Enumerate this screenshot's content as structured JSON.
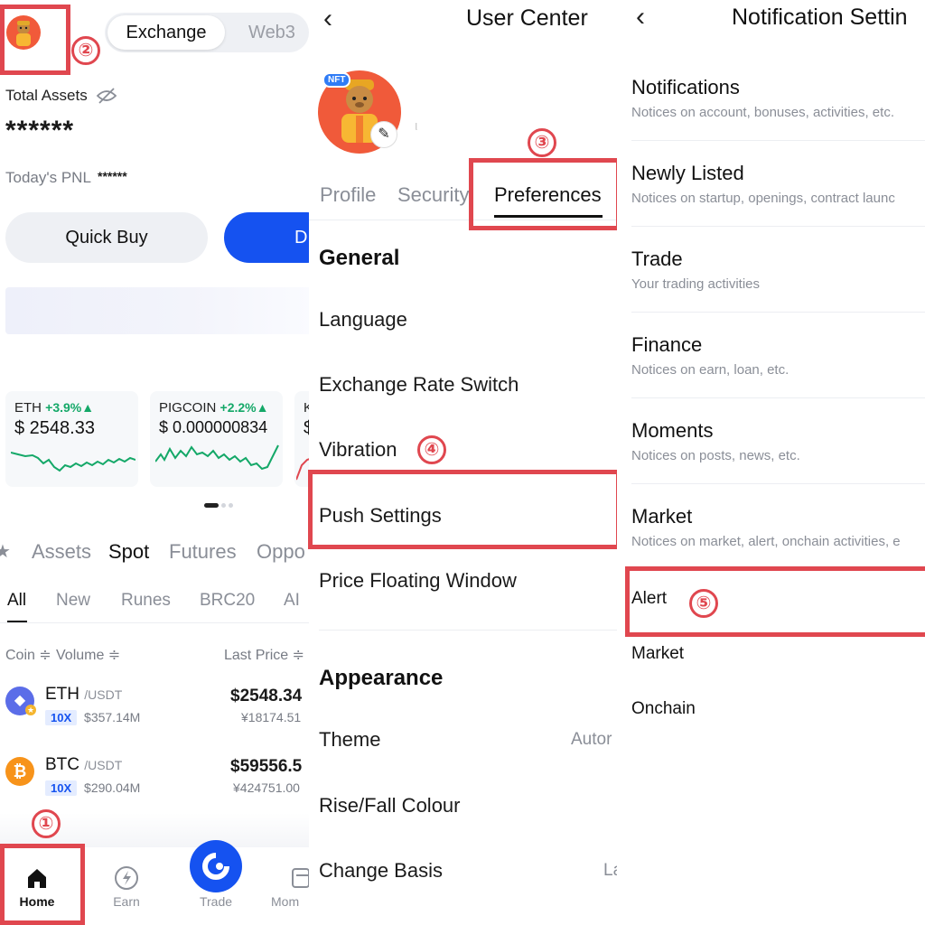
{
  "colors": {
    "accent": "#1552f0",
    "up": "#14a868",
    "annotation": "#e0474f",
    "text_muted": "#8a8e97"
  },
  "home": {
    "segment": {
      "active": "Exchange",
      "inactive": "Web3"
    },
    "total_assets_label": "Total Assets",
    "total_assets_value": "******",
    "pnl_label": "Today's PNL",
    "pnl_value": "******",
    "quick_buy_label": "Quick Buy",
    "deposit_label_partial": "D",
    "cards": [
      {
        "symbol": "ETH",
        "change": "+3.9%▲",
        "price": "$ 2548.33"
      },
      {
        "symbol": "PIGCOIN",
        "change": "+2.2%▲",
        "price": "$ 0.000000834"
      },
      {
        "symbol": "K",
        "change": "",
        "price": "$"
      }
    ],
    "market_tabs": [
      "Assets",
      "Spot",
      "Futures",
      "Oppo"
    ],
    "market_tab_active": "Spot",
    "filters": [
      "All",
      "New",
      "Runes",
      "BRC20",
      "AI"
    ],
    "filter_active": "All",
    "columns": {
      "coin": "Coin ≑",
      "volume": "Volume ≑",
      "last_price": "Last Price ≑"
    },
    "rows": [
      {
        "base": "ETH",
        "quote": "/USDT",
        "leverage": "10X",
        "volume": "$357.14M",
        "price": "$2548.34",
        "fiat": "¥18174.51",
        "icon": "ethereum-icon"
      },
      {
        "base": "BTC",
        "quote": "/USDT",
        "leverage": "10X",
        "volume": "$290.04M",
        "price": "$59556.5",
        "fiat": "¥424751.00",
        "icon": "bitcoin-icon"
      }
    ],
    "nav": [
      "Home",
      "Earn",
      "Trade",
      "Mom"
    ]
  },
  "user_center": {
    "title": "User Center",
    "nft_badge": "NFT",
    "tabs": [
      "Profile",
      "Security",
      "Preferences"
    ],
    "tab_active": "Preferences",
    "general_heading": "General",
    "general_items": [
      "Language",
      "Exchange Rate Switch",
      "Vibration",
      "Push Settings",
      "Price Floating Window"
    ],
    "appearance_heading": "Appearance",
    "appearance_items": [
      {
        "label": "Theme",
        "value": "Autor"
      },
      {
        "label": "Rise/Fall Colour",
        "value": ""
      },
      {
        "label": "Change Basis",
        "value": "La"
      }
    ]
  },
  "notification_settings": {
    "title": "Notification Settin",
    "items": [
      {
        "title": "Notifications",
        "subtitle": "Notices on account, bonuses, activities, etc."
      },
      {
        "title": "Newly Listed",
        "subtitle": "Notices on startup, openings, contract launc"
      },
      {
        "title": "Trade",
        "subtitle": "Your trading activities"
      },
      {
        "title": "Finance",
        "subtitle": "Notices on earn, loan, etc."
      },
      {
        "title": "Moments",
        "subtitle": "Notices on posts, news, etc."
      },
      {
        "title": "Market",
        "subtitle": "Notices on market, alert, onchain activities, e"
      }
    ],
    "sub_items": [
      "Alert",
      "Market",
      "Onchain"
    ]
  },
  "annotations": [
    "①",
    "②",
    "③",
    "④",
    "⑤"
  ]
}
